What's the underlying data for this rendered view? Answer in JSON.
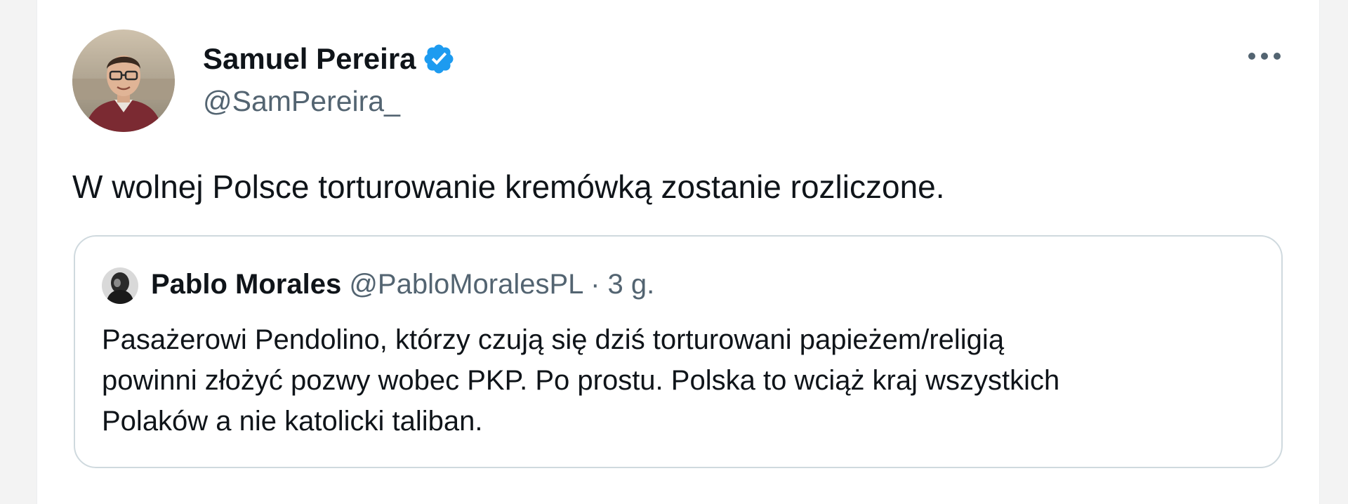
{
  "author": {
    "name": "Samuel Pereira",
    "handle": "@SamPereira_",
    "verified": true
  },
  "tweet": {
    "text": "W wolnej Polsce torturowanie kremówką zostanie rozliczone."
  },
  "quoted": {
    "name": "Pablo Morales",
    "handle": "@PabloMoralesPL",
    "separator": "·",
    "time": "3 g.",
    "lines": [
      "Pasażerowi Pendolino, którzy czują się dziś torturowani papieżem/religią",
      "powinni złożyć pozwy wobec PKP. Po prostu. Polska to wciąż kraj wszystkich",
      "Polaków a nie katolicki taliban."
    ]
  },
  "icons": {
    "verified": "verified-badge-icon",
    "more": "more-options-icon"
  },
  "colors": {
    "verified": "#1d9bf0",
    "text": "#0f1419",
    "secondary": "#536471",
    "border": "#cfd9de"
  }
}
